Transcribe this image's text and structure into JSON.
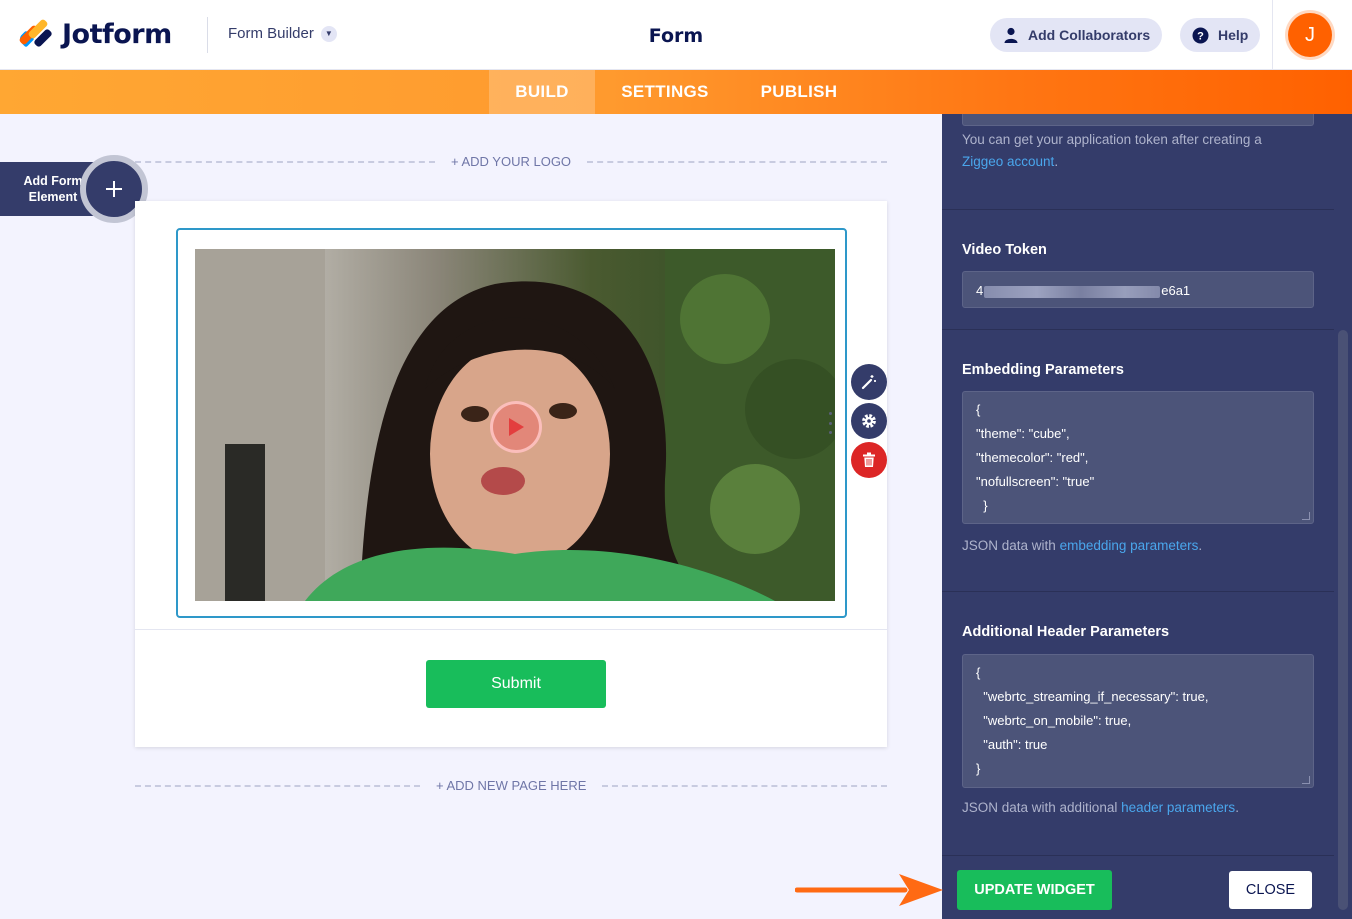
{
  "header": {
    "brand": "Jotform",
    "builder_menu": "Form Builder",
    "title": "Form",
    "add_collaborators": "Add Collaborators",
    "help": "Help",
    "avatar_initial": "J"
  },
  "tabs": [
    {
      "label": "BUILD",
      "active": true
    },
    {
      "label": "SETTINGS",
      "active": false
    },
    {
      "label": "PUBLISH",
      "active": false
    }
  ],
  "canvas": {
    "add_logo": "+ ADD YOUR LOGO",
    "add_element_label": "Add Form Element",
    "submit_label": "Submit",
    "add_page": "+ ADD NEW PAGE HERE",
    "video_play_icon": "play-icon"
  },
  "field_tools": [
    "magic-wand-icon",
    "gear-icon",
    "trash-icon"
  ],
  "panel": {
    "token_help_prefix": "You can get your application token after creating a",
    "token_help_link": "Ziggeo account",
    "token_help_suffix": ".",
    "video_token_label": "Video Token",
    "video_token_start": "4",
    "video_token_end": "e6a1",
    "embedding_label": "Embedding Parameters",
    "embedding_lines": [
      "{",
      "\"theme\": \"cube\",",
      "\"themecolor\": \"red\",",
      "\"nofullscreen\": \"true\"",
      "  }"
    ],
    "embedding_help_prefix": "JSON data with",
    "embedding_help_link": "embedding parameters",
    "embedding_help_suffix": ".",
    "header_label": "Additional Header Parameters",
    "header_lines": [
      "{",
      "  \"webrtc_streaming_if_necessary\": true,",
      "  \"webrtc_on_mobile\": true,",
      "  \"auth\": true",
      "}"
    ],
    "header_help_prefix": "JSON data with additional",
    "header_help_link": "header parameters",
    "header_help_suffix": ".",
    "update_button": "UPDATE WIDGET",
    "close_button": "CLOSE"
  },
  "colors": {
    "brand_orange": "#ff6100",
    "navy": "#0a1551",
    "panel": "#343c6a",
    "success": "#18bd5b",
    "link": "#4aa6ec",
    "selection": "#2e98c9",
    "annotation_arrow": "#ff6a13"
  }
}
